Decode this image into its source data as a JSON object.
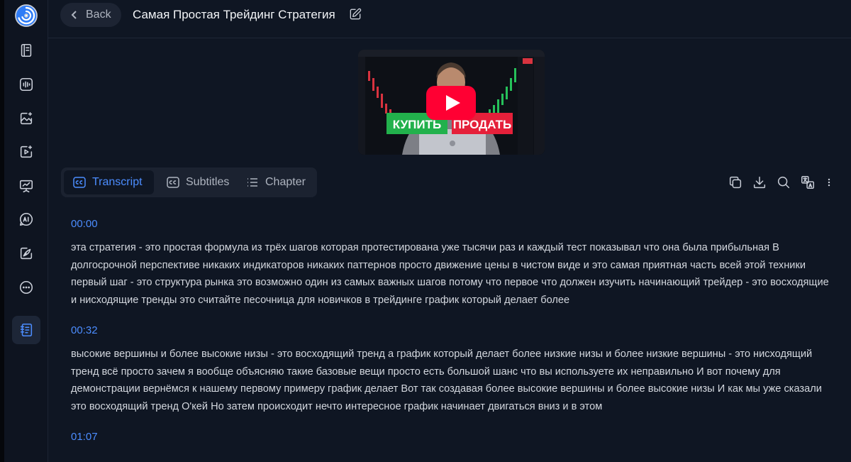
{
  "header": {
    "back_label": "Back",
    "title": "Самая Простая Трейдинг Стратегия"
  },
  "video": {
    "thumb_buy_label": "КУПИТЬ",
    "thumb_sell_label": "ПРОДАТЬ",
    "accent_red": "#ff0033",
    "buy_green": "#22b14c",
    "sell_red": "#e5203a"
  },
  "tabs": [
    {
      "label": "Transcript",
      "icon": "cc-icon",
      "active": true
    },
    {
      "label": "Subtitles",
      "icon": "cc-icon",
      "active": false
    },
    {
      "label": "Chapter",
      "icon": "list-icon",
      "active": false
    }
  ],
  "toolbar": [
    "copy-icon",
    "download-icon",
    "search-icon",
    "translate-icon",
    "more-vertical-icon"
  ],
  "sidebar": [
    "logo-icon",
    "notebook-icon",
    "audio-wave-icon",
    "image-sparkle-icon",
    "video-sparkle-icon",
    "presentation-icon",
    "ai-chat-icon",
    "pen-sparkle-icon",
    "more-icon",
    "notes-icon"
  ],
  "accent_color": "#4c8dff",
  "transcript": [
    {
      "time": "00:00",
      "text": "эта стратегия - это простая формула из трёх шагов которая протестирована уже тысячи раз и каждый тест показывал что она была прибыльная В долгосрочной перспективе никаких индикаторов никаких паттернов просто движение цены в чистом виде и это самая приятная часть всей этой техники первый шаг - это структура рынка это возможно один из самых важных шагов потому что первое что должен изучить начинающий трейдер - это восходящие и нисходящие тренды это считайте песочница для новичков в трейдинге график который делает более"
    },
    {
      "time": "00:32",
      "text": "высокие вершины и более высокие низы - это восходящий тренд а график который делает более низкие низы и более низкие вершины - это нисходящий тренд всё просто зачем я вообще объясняю такие базовые вещи просто есть большой шанс что вы используете их неправильно И вот почему для демонстрации вернёмся к нашему первому примеру график делает Вот так создавая более высокие вершины и более высокие низы И как мы уже сказали это восходящий тренд О'кей Но затем происходит нечто интересное график начинает двигаться вниз и в этом"
    },
    {
      "time": "01:07",
      "text": ""
    }
  ]
}
